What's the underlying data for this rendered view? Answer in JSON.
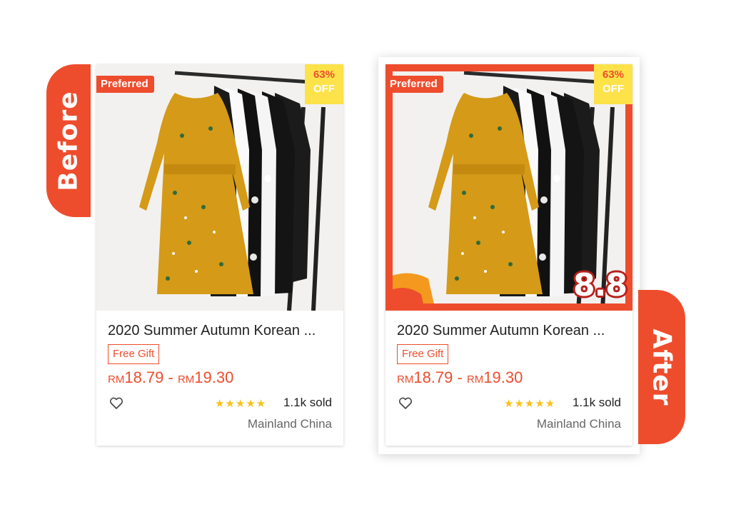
{
  "labels": {
    "before": "Before",
    "after": "After"
  },
  "product": {
    "badge": "Preferred",
    "discount_percent": "63%",
    "discount_word": "OFF",
    "title": "2020 Summer Autumn Korean ...",
    "tag": "Free Gift",
    "currency": "RM",
    "price_low": "18.79",
    "price_separator": " - ",
    "price_high": "19.30",
    "rating_stars": "★★★★★",
    "sold": "1.1k sold",
    "location": "Mainland China",
    "rating": 5
  },
  "campaign": {
    "sale_label": "8.8"
  },
  "colors": {
    "accent": "#ee4d2d",
    "discount_badge": "#fde24a",
    "stars": "#f8c119",
    "dress": "#d49a18"
  },
  "icons": {
    "wishlist": "heart-outline-icon"
  }
}
